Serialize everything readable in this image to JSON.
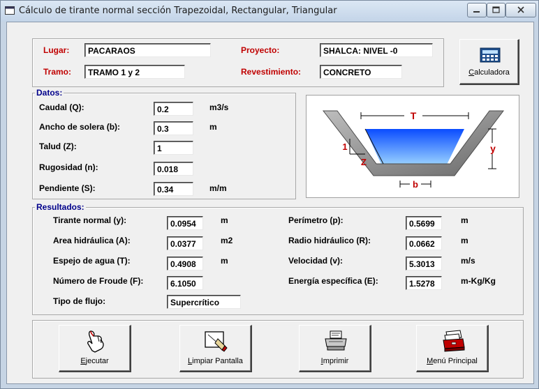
{
  "window": {
    "title": "Cálculo de tirante normal sección Trapezoidal, Rectangular, Triangular"
  },
  "header": {
    "lugar_label": "Lugar:",
    "lugar_value": "PACARAOS",
    "tramo_label": "Tramo:",
    "tramo_value": "TRAMO 1 y 2",
    "proyecto_label": "Proyecto:",
    "proyecto_value": "SHALCA: NIVEL -0",
    "revestimiento_label": "Revestimiento:",
    "revestimiento_value": "CONCRETO",
    "calc_label": "Calculadora",
    "calc_mnemonic": "C",
    "calc_rest": "alculadora"
  },
  "datos": {
    "title": "Datos:",
    "caudal_label": "Caudal (Q):",
    "caudal_value": "0.2",
    "caudal_unit": "m3/s",
    "ancho_label": "Ancho de solera (b):",
    "ancho_value": "0.3",
    "ancho_unit": "m",
    "talud_label": "Talud (Z):",
    "talud_value": "1",
    "rugosidad_label": "Rugosidad (n):",
    "rugosidad_value": "0.018",
    "pendiente_label": "Pendiente (S):",
    "pendiente_value": "0.34",
    "pendiente_unit": "m/m"
  },
  "diagram": {
    "T": "T",
    "y": "y",
    "one": "1",
    "Z": "Z",
    "b": "b",
    "water_color": "#1a6cff"
  },
  "resultados": {
    "title": "Resultados:",
    "tirante_label": "Tirante normal (y):",
    "tirante_value": "0.0954",
    "tirante_unit": "m",
    "area_label": "Area hidráulica (A):",
    "area_value": "0.0377",
    "area_unit": "m2",
    "espejo_label": "Espejo de agua (T):",
    "espejo_value": "0.4908",
    "espejo_unit": "m",
    "froude_label": "Número de Froude (F):",
    "froude_value": "6.1050",
    "tipo_label": "Tipo de flujo:",
    "tipo_value": "Supercrítico",
    "perimetro_label": "Perímetro (p):",
    "perimetro_value": "0.5699",
    "perimetro_unit": "m",
    "radio_label": "Radio hidráulico (R):",
    "radio_value": "0.0662",
    "radio_unit": "m",
    "velocidad_label": "Velocidad (v):",
    "velocidad_value": "5.3013",
    "velocidad_unit": "m/s",
    "energia_label": "Energía específica (E):",
    "energia_value": "1.5278",
    "energia_unit": "m-Kg/Kg"
  },
  "buttons": {
    "ejecutar": {
      "label": "Ejecutar",
      "mnemonic": "E",
      "rest": "jecutar"
    },
    "limpiar": {
      "label": "Limpiar Pantalla",
      "mnemonic": "L",
      "rest": "impiar Pantalla"
    },
    "imprimir": {
      "label": "Imprimir",
      "mnemonic": "I",
      "rest": "mprimir"
    },
    "menu": {
      "label": "Menú Principal",
      "mnemonic": "M",
      "rest": "enú Principal"
    }
  },
  "colors": {
    "label_red": "#c00000",
    "label_blue": "#00008b",
    "window_bg": "#f0f0f0"
  }
}
